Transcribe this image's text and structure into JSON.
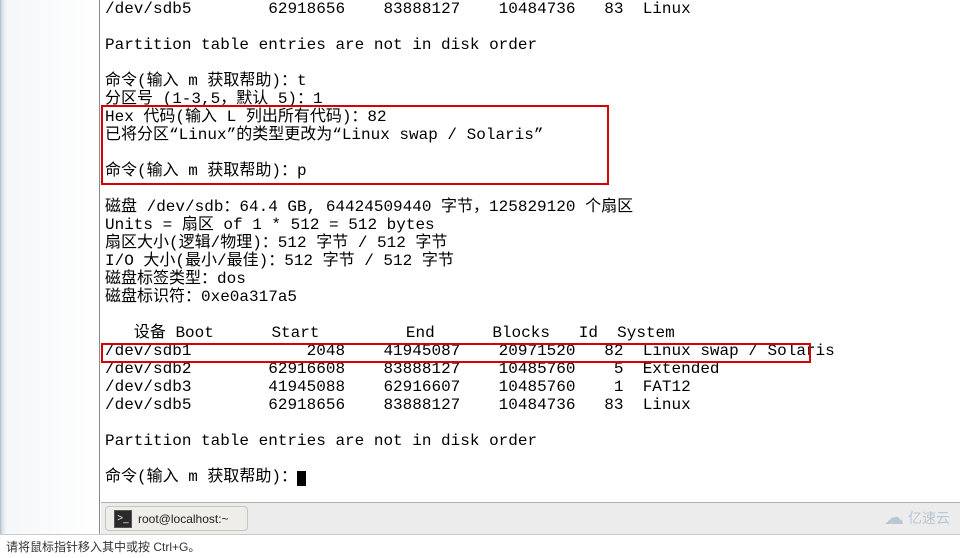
{
  "terminal": {
    "top_row": {
      "device": "/dev/sdb5",
      "boot": "",
      "start": "62918656",
      "end": "83888127",
      "blocks": "10484736",
      "id": "83",
      "system": "Linux"
    },
    "warn1": "Partition table entries are not in disk order",
    "prompt_t": "命令(输入 m 获取帮助)：t",
    "partnum": "分区号 (1-3,5，默认 5)：1",
    "hex": "Hex 代码(输入 L 列出所有代码)：82",
    "changed": "已将分区“Linux”的类型更改为“Linux swap / Solaris”",
    "prompt_p": "命令(输入 m 获取帮助)：p",
    "disk_line": "磁盘 /dev/sdb：64.4 GB, 64424509440 字节，125829120 个扇区",
    "units": "Units = 扇区 of 1 * 512 = 512 bytes",
    "sector": "扇区大小(逻辑/物理)：512 字节 / 512 字节",
    "io": "I/O 大小(最小/最佳)：512 字节 / 512 字节",
    "label": "磁盘标签类型：dos",
    "ident": "磁盘标识符：0xe0a317a5",
    "header": {
      "device": "设备",
      "boot": "Boot",
      "start": "Start",
      "end": "End",
      "blocks": "Blocks",
      "id": "Id",
      "system": "System"
    },
    "rows": [
      {
        "device": "/dev/sdb1",
        "boot": "",
        "start": "2048",
        "end": "41945087",
        "blocks": "20971520",
        "id": "82",
        "system": "Linux swap / Solaris"
      },
      {
        "device": "/dev/sdb2",
        "boot": "",
        "start": "62916608",
        "end": "83888127",
        "blocks": "10485760",
        "id": "5",
        "system": "Extended"
      },
      {
        "device": "/dev/sdb3",
        "boot": "",
        "start": "41945088",
        "end": "62916607",
        "blocks": "10485760",
        "id": "1",
        "system": "FAT12"
      },
      {
        "device": "/dev/sdb5",
        "boot": "",
        "start": "62918656",
        "end": "83888127",
        "blocks": "10484736",
        "id": "83",
        "system": "Linux"
      }
    ],
    "warn2": "Partition table entries are not in disk order",
    "prompt_final": "命令(输入 m 获取帮助)："
  },
  "taskbar": {
    "title": "root@localhost:~"
  },
  "status": {
    "hint": "请将鼠标指针移入其中或按 Ctrl+G。"
  },
  "watermark": {
    "text": "亿速云"
  }
}
